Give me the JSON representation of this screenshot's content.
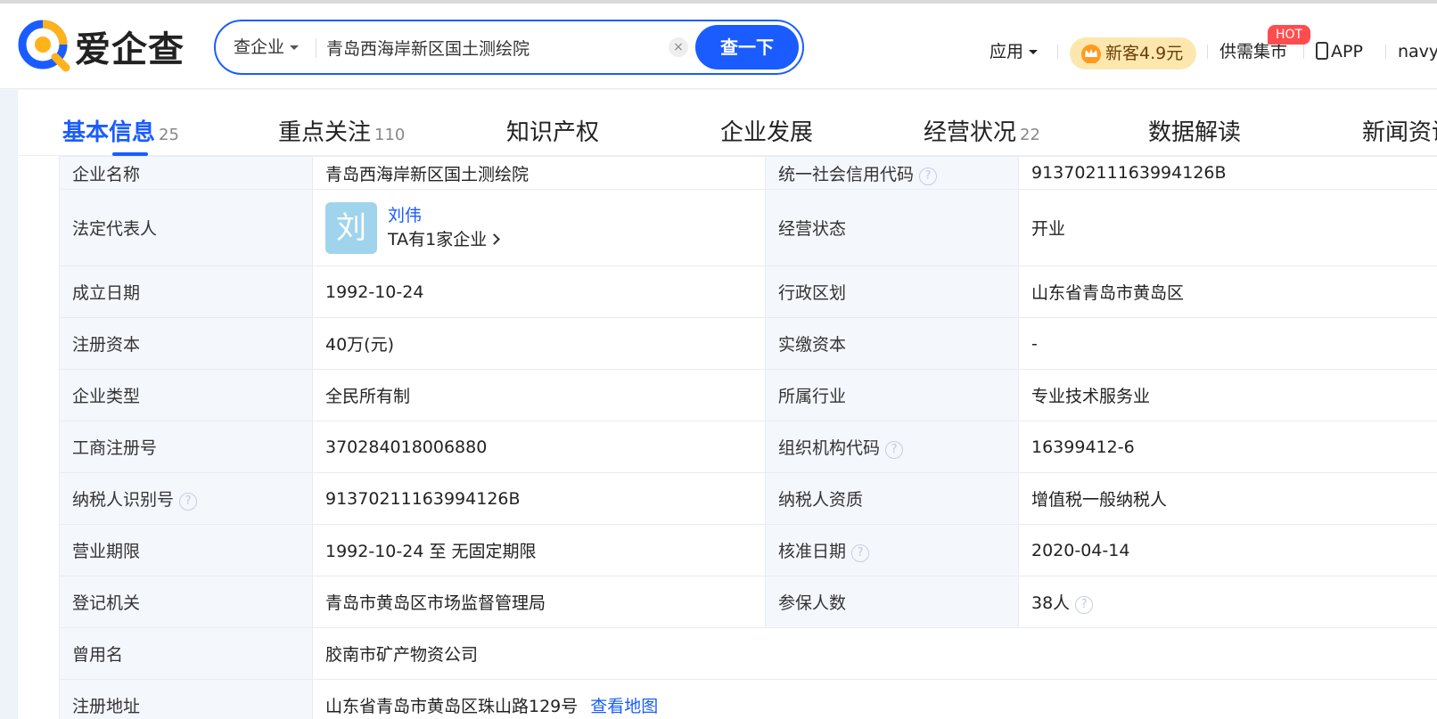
{
  "header": {
    "logo_text": "爱企查",
    "search": {
      "type_label": "查企业",
      "query": "青岛西海岸新区国土测绘院",
      "clear_symbol": "×",
      "button_label": "查一下"
    },
    "nav": {
      "apps_label": "应用",
      "vip_label": "新客4.9元",
      "supply_label": "供需集市",
      "hot_badge": "HOT",
      "app_label": "APP",
      "user_label": "navy"
    },
    "colors": {
      "brand": "#1a5cff",
      "vip_bg": "#fde7ae",
      "hot": "#ff4d4f"
    }
  },
  "tabs": [
    {
      "label": "基本信息",
      "count": "25",
      "active": true
    },
    {
      "label": "重点关注",
      "count": "110"
    },
    {
      "label": "知识产权",
      "count": ""
    },
    {
      "label": "企业发展",
      "count": ""
    },
    {
      "label": "经营状况",
      "count": "22"
    },
    {
      "label": "数据解读",
      "count": ""
    },
    {
      "label": "新闻资讯",
      "count": ""
    }
  ],
  "info": {
    "company_name_label": "企业名称",
    "company_name": "青岛西海岸新区国土测绘院",
    "credit_code_label": "统一社会信用代码",
    "credit_code": "91370211163994126B",
    "legal_rep_label": "法定代表人",
    "legal_rep_avatar": "刘",
    "legal_rep_name": "刘伟",
    "legal_rep_companies": "TA有1家企业",
    "status_label": "经营状态",
    "status": "开业",
    "founded_label": "成立日期",
    "founded": "1992-10-24",
    "region_label": "行政区划",
    "region": "山东省青岛市黄岛区",
    "reg_capital_label": "注册资本",
    "reg_capital": "40万(元)",
    "paid_capital_label": "实缴资本",
    "paid_capital": "-",
    "type_label": "企业类型",
    "type": "全民所有制",
    "industry_label": "所属行业",
    "industry": "专业技术服务业",
    "reg_no_label": "工商注册号",
    "reg_no": "370284018006880",
    "org_code_label": "组织机构代码",
    "org_code": "16399412-6",
    "taxpayer_id_label": "纳税人识别号",
    "taxpayer_id": "91370211163994126B",
    "taxpayer_qual_label": "纳税人资质",
    "taxpayer_qual": "增值税一般纳税人",
    "term_label": "营业期限",
    "term": "1992-10-24 至 无固定期限",
    "approval_date_label": "核准日期",
    "approval_date": "2020-04-14",
    "authority_label": "登记机关",
    "authority": "青岛市黄岛区市场监督管理局",
    "insured_label": "参保人数",
    "insured": "38人",
    "former_name_label": "曾用名",
    "former_name": "胶南市矿产物资公司",
    "address_label": "注册地址",
    "address": "山东省青岛市黄岛区珠山路129号",
    "map_link": "查看地图",
    "help_symbol": "?"
  }
}
